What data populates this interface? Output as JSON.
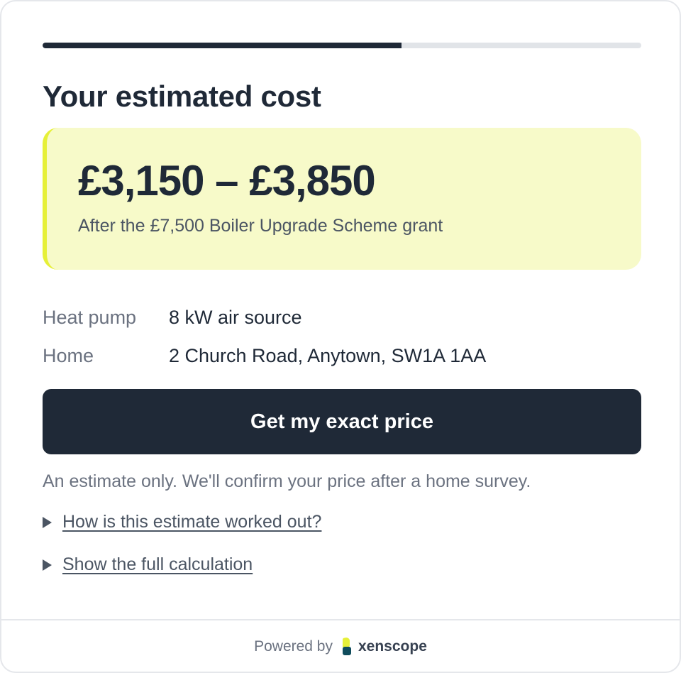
{
  "progress": {
    "fraction": 0.6
  },
  "title": "Your estimated cost",
  "estimate": {
    "range": "£3,150 – £3,850",
    "note": "After the £7,500 Boiler Upgrade Scheme grant"
  },
  "details": [
    {
      "label": "Heat pump",
      "value": "8 kW air source"
    },
    {
      "label": "Home",
      "value": "2 Church Road, Anytown, SW1A 1AA"
    }
  ],
  "cta_label": "Get my exact price",
  "disclaimer": "An estimate only. We'll confirm your price after a home survey.",
  "disclosures": [
    {
      "label": "How is this estimate worked out?"
    },
    {
      "label": "Show the full calculation"
    }
  ],
  "footer": {
    "powered_by": "Powered by",
    "brand": "xenscope"
  },
  "colors": {
    "accent": "#e6f038",
    "highlight_bg": "#f7fac9",
    "primary": "#1f2937",
    "brand_mark": "#0f4c5c"
  }
}
